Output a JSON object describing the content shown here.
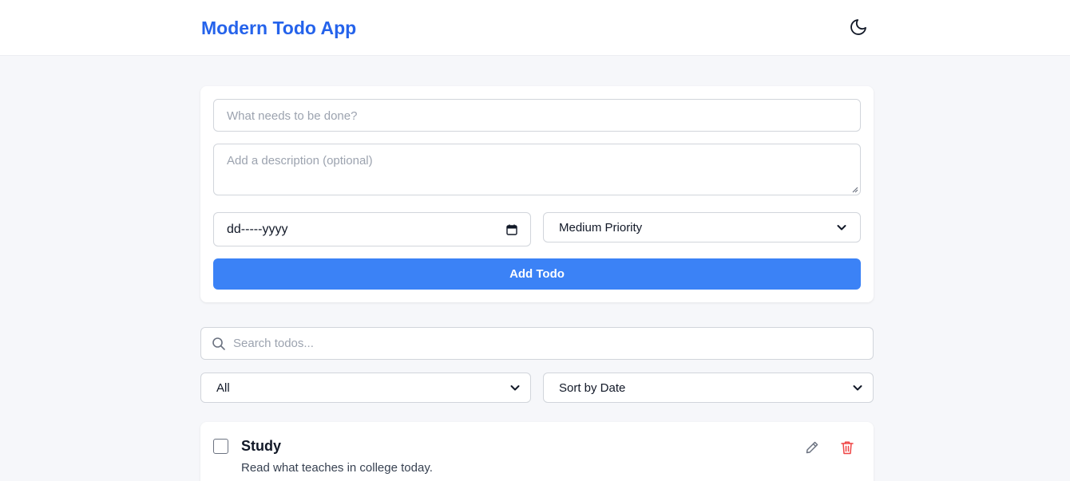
{
  "header": {
    "title": "Modern Todo App",
    "theme_icon": "moon-icon",
    "accent_color": "#2563eb"
  },
  "form": {
    "title_placeholder": "What needs to be done?",
    "description_placeholder": "Add a description (optional)",
    "date_placeholder": "dd-----yyyy",
    "priority_selected": "Medium Priority",
    "add_button_label": "Add Todo",
    "button_color": "#3b82f6"
  },
  "controls": {
    "search_placeholder": "Search todos...",
    "filter_selected": "All",
    "sort_selected": "Sort by Date"
  },
  "todos": [
    {
      "title": "Study",
      "description": "Read what teaches in college today.",
      "completed": false
    }
  ],
  "colors": {
    "delete": "#ef4444",
    "edit": "#6b7280",
    "background": "#f6f7fa"
  }
}
